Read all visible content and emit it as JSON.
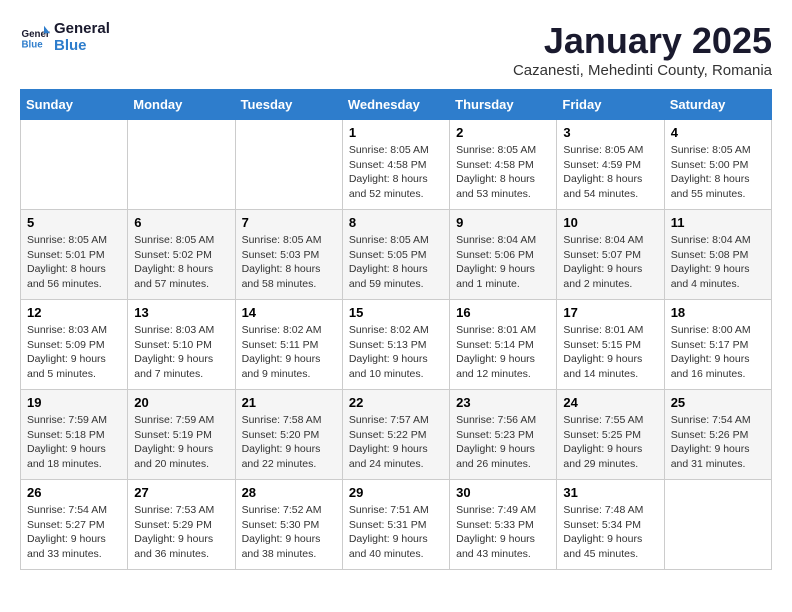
{
  "logo": {
    "line1": "General",
    "line2": "Blue"
  },
  "title": "January 2025",
  "location": "Cazanesti, Mehedinti County, Romania",
  "weekdays": [
    "Sunday",
    "Monday",
    "Tuesday",
    "Wednesday",
    "Thursday",
    "Friday",
    "Saturday"
  ],
  "weeks": [
    [
      {
        "day": "",
        "info": ""
      },
      {
        "day": "",
        "info": ""
      },
      {
        "day": "",
        "info": ""
      },
      {
        "day": "1",
        "info": "Sunrise: 8:05 AM\nSunset: 4:58 PM\nDaylight: 8 hours and 52 minutes."
      },
      {
        "day": "2",
        "info": "Sunrise: 8:05 AM\nSunset: 4:58 PM\nDaylight: 8 hours and 53 minutes."
      },
      {
        "day": "3",
        "info": "Sunrise: 8:05 AM\nSunset: 4:59 PM\nDaylight: 8 hours and 54 minutes."
      },
      {
        "day": "4",
        "info": "Sunrise: 8:05 AM\nSunset: 5:00 PM\nDaylight: 8 hours and 55 minutes."
      }
    ],
    [
      {
        "day": "5",
        "info": "Sunrise: 8:05 AM\nSunset: 5:01 PM\nDaylight: 8 hours and 56 minutes."
      },
      {
        "day": "6",
        "info": "Sunrise: 8:05 AM\nSunset: 5:02 PM\nDaylight: 8 hours and 57 minutes."
      },
      {
        "day": "7",
        "info": "Sunrise: 8:05 AM\nSunset: 5:03 PM\nDaylight: 8 hours and 58 minutes."
      },
      {
        "day": "8",
        "info": "Sunrise: 8:05 AM\nSunset: 5:05 PM\nDaylight: 8 hours and 59 minutes."
      },
      {
        "day": "9",
        "info": "Sunrise: 8:04 AM\nSunset: 5:06 PM\nDaylight: 9 hours and 1 minute."
      },
      {
        "day": "10",
        "info": "Sunrise: 8:04 AM\nSunset: 5:07 PM\nDaylight: 9 hours and 2 minutes."
      },
      {
        "day": "11",
        "info": "Sunrise: 8:04 AM\nSunset: 5:08 PM\nDaylight: 9 hours and 4 minutes."
      }
    ],
    [
      {
        "day": "12",
        "info": "Sunrise: 8:03 AM\nSunset: 5:09 PM\nDaylight: 9 hours and 5 minutes."
      },
      {
        "day": "13",
        "info": "Sunrise: 8:03 AM\nSunset: 5:10 PM\nDaylight: 9 hours and 7 minutes."
      },
      {
        "day": "14",
        "info": "Sunrise: 8:02 AM\nSunset: 5:11 PM\nDaylight: 9 hours and 9 minutes."
      },
      {
        "day": "15",
        "info": "Sunrise: 8:02 AM\nSunset: 5:13 PM\nDaylight: 9 hours and 10 minutes."
      },
      {
        "day": "16",
        "info": "Sunrise: 8:01 AM\nSunset: 5:14 PM\nDaylight: 9 hours and 12 minutes."
      },
      {
        "day": "17",
        "info": "Sunrise: 8:01 AM\nSunset: 5:15 PM\nDaylight: 9 hours and 14 minutes."
      },
      {
        "day": "18",
        "info": "Sunrise: 8:00 AM\nSunset: 5:17 PM\nDaylight: 9 hours and 16 minutes."
      }
    ],
    [
      {
        "day": "19",
        "info": "Sunrise: 7:59 AM\nSunset: 5:18 PM\nDaylight: 9 hours and 18 minutes."
      },
      {
        "day": "20",
        "info": "Sunrise: 7:59 AM\nSunset: 5:19 PM\nDaylight: 9 hours and 20 minutes."
      },
      {
        "day": "21",
        "info": "Sunrise: 7:58 AM\nSunset: 5:20 PM\nDaylight: 9 hours and 22 minutes."
      },
      {
        "day": "22",
        "info": "Sunrise: 7:57 AM\nSunset: 5:22 PM\nDaylight: 9 hours and 24 minutes."
      },
      {
        "day": "23",
        "info": "Sunrise: 7:56 AM\nSunset: 5:23 PM\nDaylight: 9 hours and 26 minutes."
      },
      {
        "day": "24",
        "info": "Sunrise: 7:55 AM\nSunset: 5:25 PM\nDaylight: 9 hours and 29 minutes."
      },
      {
        "day": "25",
        "info": "Sunrise: 7:54 AM\nSunset: 5:26 PM\nDaylight: 9 hours and 31 minutes."
      }
    ],
    [
      {
        "day": "26",
        "info": "Sunrise: 7:54 AM\nSunset: 5:27 PM\nDaylight: 9 hours and 33 minutes."
      },
      {
        "day": "27",
        "info": "Sunrise: 7:53 AM\nSunset: 5:29 PM\nDaylight: 9 hours and 36 minutes."
      },
      {
        "day": "28",
        "info": "Sunrise: 7:52 AM\nSunset: 5:30 PM\nDaylight: 9 hours and 38 minutes."
      },
      {
        "day": "29",
        "info": "Sunrise: 7:51 AM\nSunset: 5:31 PM\nDaylight: 9 hours and 40 minutes."
      },
      {
        "day": "30",
        "info": "Sunrise: 7:49 AM\nSunset: 5:33 PM\nDaylight: 9 hours and 43 minutes."
      },
      {
        "day": "31",
        "info": "Sunrise: 7:48 AM\nSunset: 5:34 PM\nDaylight: 9 hours and 45 minutes."
      },
      {
        "day": "",
        "info": ""
      }
    ]
  ]
}
